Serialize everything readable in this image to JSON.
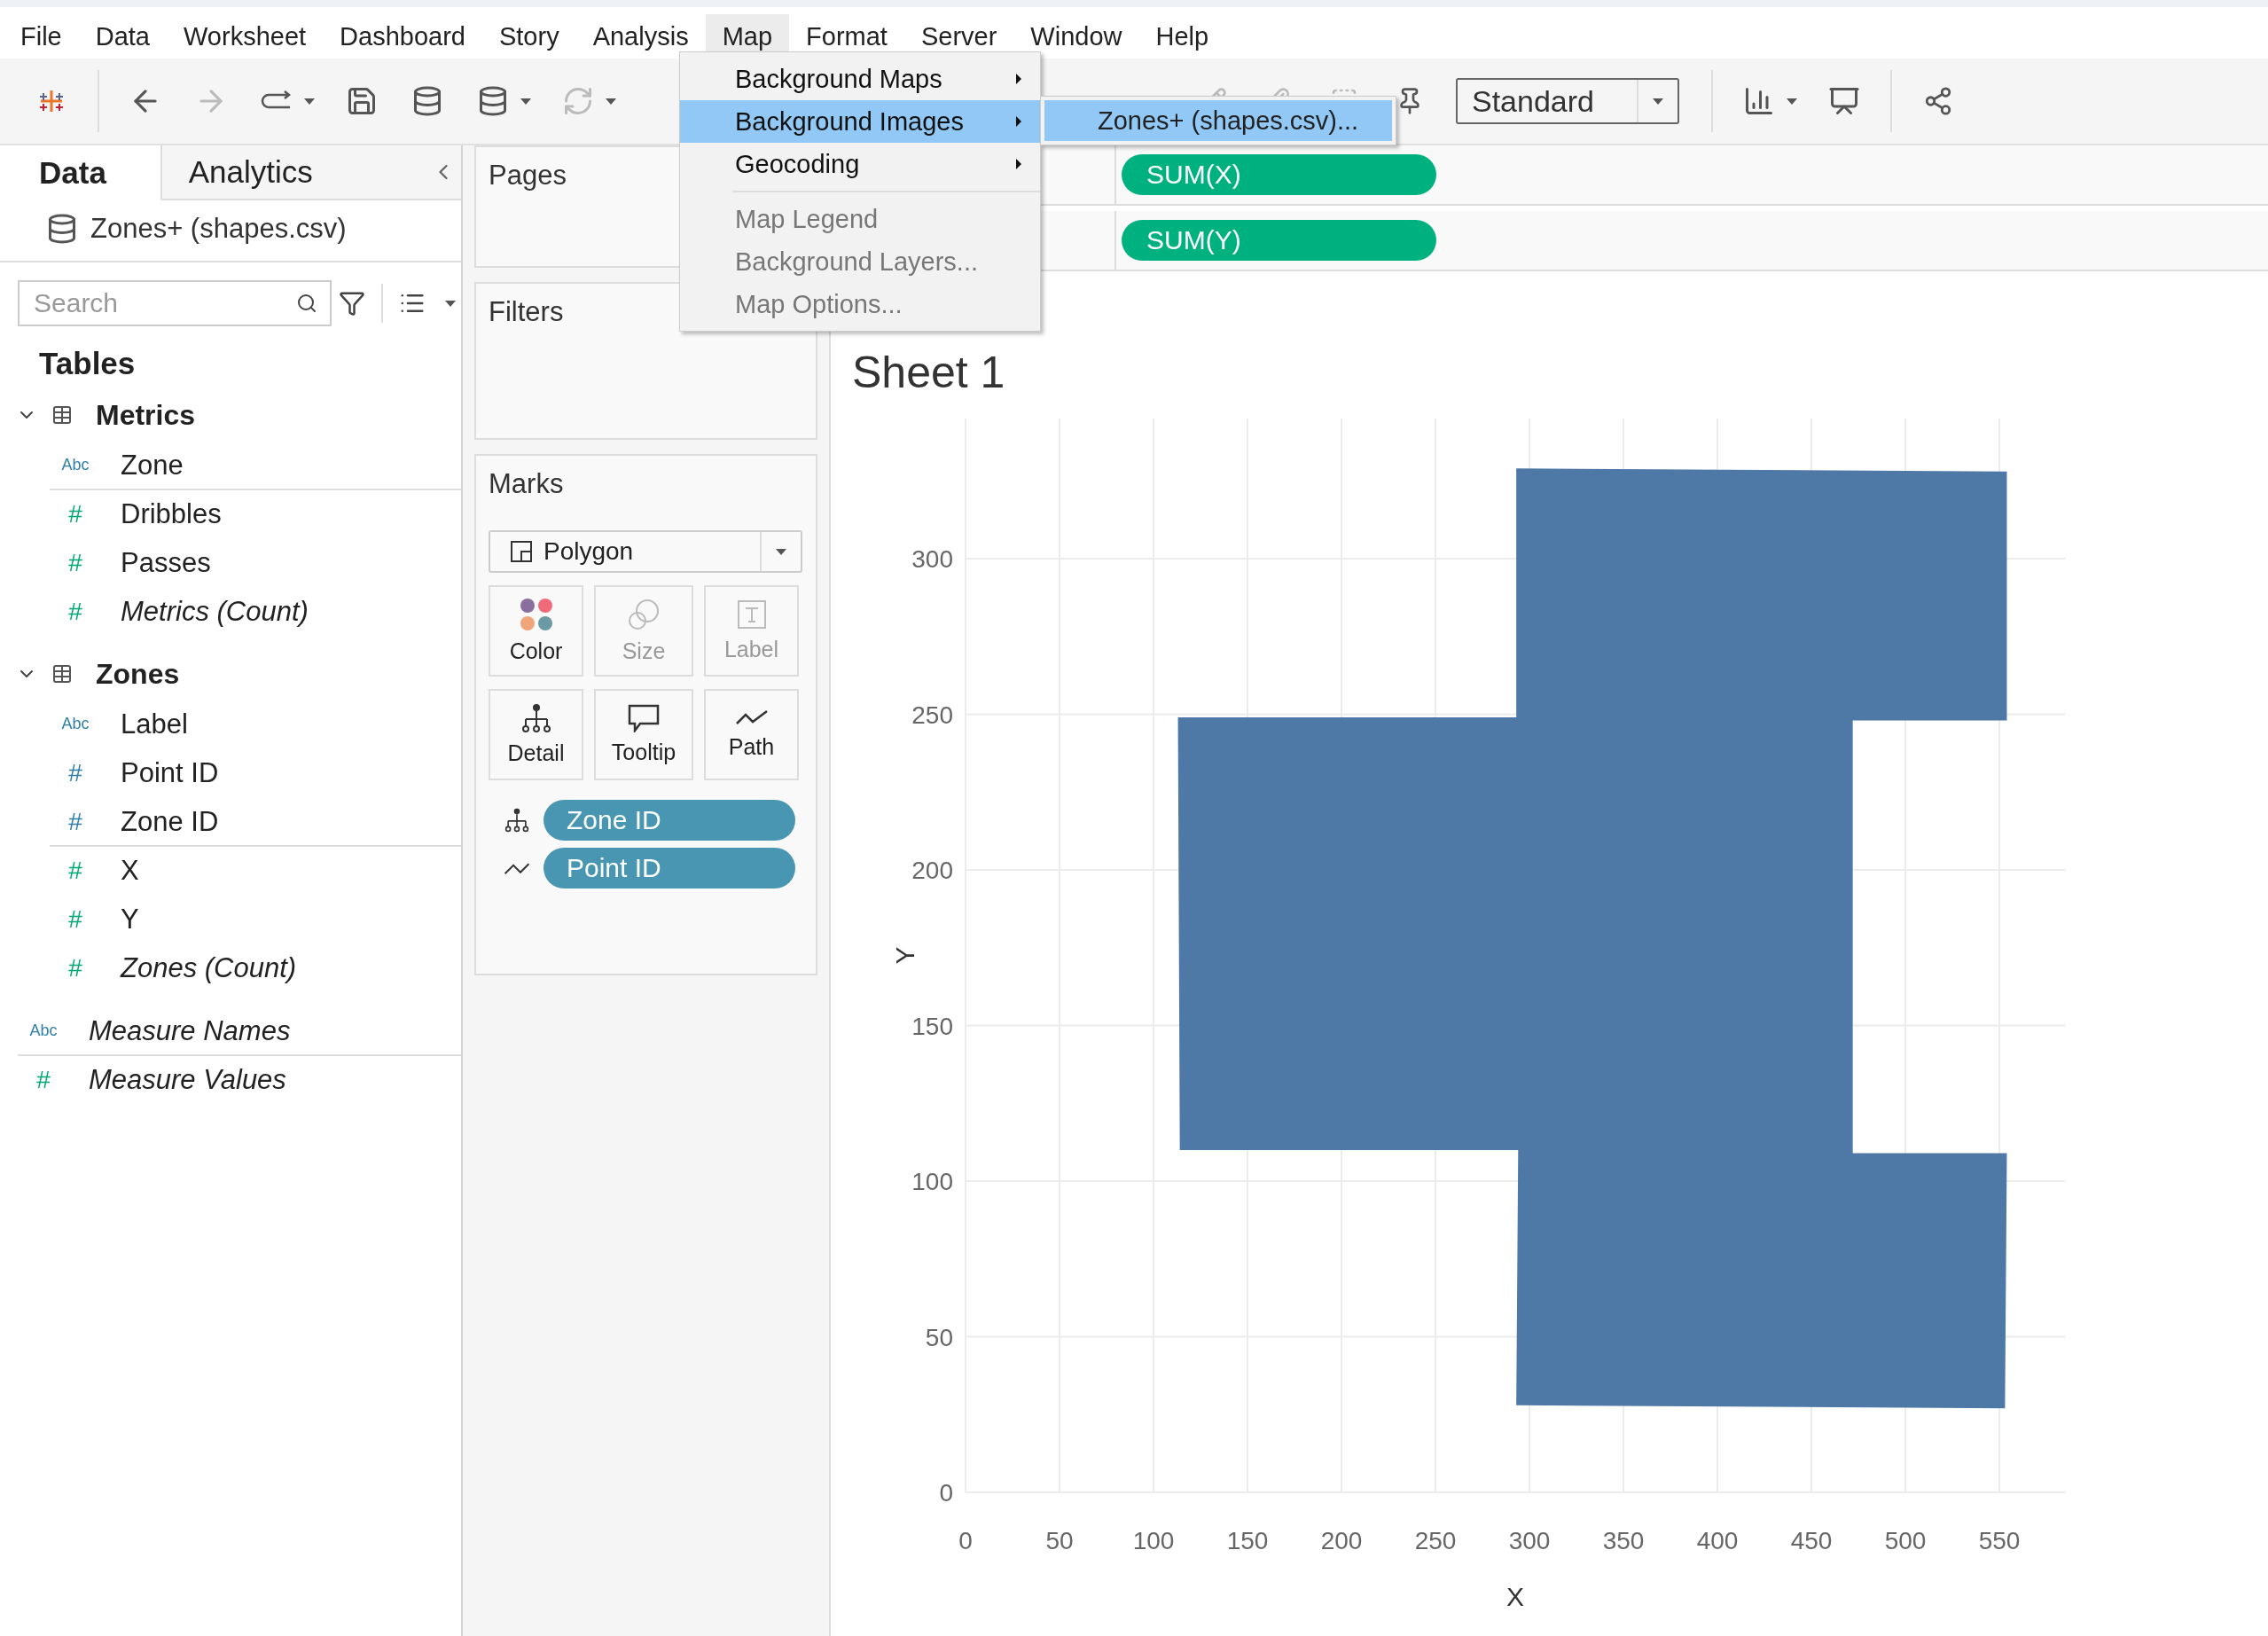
{
  "menu_bar": [
    {
      "label": "File",
      "selected": false
    },
    {
      "label": "Data",
      "selected": false
    },
    {
      "label": "Worksheet",
      "selected": false
    },
    {
      "label": "Dashboard",
      "selected": false
    },
    {
      "label": "Story",
      "selected": false
    },
    {
      "label": "Analysis",
      "selected": false
    },
    {
      "label": "Map",
      "selected": true
    },
    {
      "label": "Format",
      "selected": false
    },
    {
      "label": "Server",
      "selected": false
    },
    {
      "label": "Window",
      "selected": false
    },
    {
      "label": "Help",
      "selected": false
    }
  ],
  "map_menu": {
    "items": [
      {
        "kind": "submenu",
        "label": "Background Maps",
        "selected": false,
        "disabled": false
      },
      {
        "kind": "submenu",
        "label": "Background Images",
        "selected": true,
        "disabled": false
      },
      {
        "kind": "submenu",
        "label": "Geocoding",
        "selected": false,
        "disabled": false
      },
      {
        "kind": "separator"
      },
      {
        "kind": "command",
        "label": "Map Legend",
        "selected": false,
        "disabled": true
      },
      {
        "kind": "command",
        "label": "Background Layers...",
        "selected": false,
        "disabled": true
      },
      {
        "kind": "command",
        "label": "Map Options...",
        "selected": false,
        "disabled": true
      }
    ],
    "submenu": [
      {
        "label": "Zones+ (shapes.csv)...",
        "selected": true
      }
    ]
  },
  "toolbar": {
    "view_size": "Standard"
  },
  "data_pane": {
    "tabs": [
      {
        "label": "Data",
        "selected": true
      },
      {
        "label": "Analytics",
        "selected": false
      }
    ],
    "data_source": "Zones+ (shapes.csv)",
    "search": {
      "placeholder": "Search"
    },
    "tables_heading": "Tables",
    "tables": [
      {
        "name": "Metrics",
        "expanded": true,
        "fields": [
          {
            "icon": "Abc",
            "kind": "dimension",
            "name": "Zone",
            "generated": false
          },
          {
            "icon": "#",
            "kind": "measure",
            "name": "Dribbles",
            "generated": false
          },
          {
            "icon": "#",
            "kind": "measure",
            "name": "Passes",
            "generated": false
          },
          {
            "icon": "#",
            "kind": "measure",
            "name": "Metrics (Count)",
            "generated": true
          }
        ]
      },
      {
        "name": "Zones",
        "expanded": true,
        "fields": [
          {
            "icon": "Abc",
            "kind": "dimension",
            "name": "Label",
            "generated": false
          },
          {
            "icon": "#",
            "kind": "dimension",
            "name": "Point ID",
            "generated": false
          },
          {
            "icon": "#",
            "kind": "dimension",
            "name": "Zone ID",
            "generated": false
          },
          {
            "icon": "#",
            "kind": "measure",
            "name": "X",
            "generated": false
          },
          {
            "icon": "#",
            "kind": "measure",
            "name": "Y",
            "generated": false
          },
          {
            "icon": "#",
            "kind": "measure",
            "name": "Zones (Count)",
            "generated": true
          }
        ]
      }
    ],
    "extra_fields": [
      {
        "icon": "Abc",
        "kind": "dimension",
        "name": "Measure Names",
        "generated": true
      },
      {
        "icon": "#",
        "kind": "measure",
        "name": "Measure Values",
        "generated": true
      }
    ]
  },
  "pages": {
    "title": "Pages"
  },
  "filters": {
    "title": "Filters"
  },
  "marks": {
    "title": "Marks",
    "mark_type": "Polygon",
    "properties": [
      {
        "kind": "color",
        "label": "Color",
        "disabled": false
      },
      {
        "kind": "size",
        "label": "Size",
        "disabled": true
      },
      {
        "kind": "label",
        "label": "Label",
        "disabled": true
      },
      {
        "kind": "detail",
        "label": "Detail",
        "disabled": false
      },
      {
        "kind": "tooltip",
        "label": "Tooltip",
        "disabled": false
      },
      {
        "kind": "path",
        "label": "Path",
        "disabled": false
      }
    ],
    "pills": [
      {
        "kind": "detail",
        "label": "Zone ID"
      },
      {
        "kind": "path",
        "label": "Point ID"
      }
    ]
  },
  "columns_shelf": [
    {
      "label": "SUM(X)"
    }
  ],
  "rows_shelf": [
    {
      "label": "SUM(Y)"
    }
  ],
  "sheet": {
    "title": "Sheet 1",
    "chart_data": {
      "type": "area",
      "grid": true,
      "xlabel": "X",
      "ylabel": "Y",
      "x": [
        293,
        554,
        554,
        472,
        472,
        554,
        553,
        293,
        294,
        114,
        113,
        293
      ],
      "series": [
        {
          "color": "#4e79a7",
          "values": [
            329,
            328,
            248,
            248,
            109,
            109,
            27,
            28,
            110,
            110,
            249,
            249
          ]
        }
      ],
      "xlim": [
        0,
        585
      ],
      "ylim": [
        0,
        345
      ],
      "xticks": [
        0,
        50,
        100,
        150,
        200,
        250,
        300,
        350,
        400,
        450,
        500,
        550
      ],
      "yticks": [
        0,
        50,
        100,
        150,
        200,
        250,
        300
      ]
    }
  }
}
